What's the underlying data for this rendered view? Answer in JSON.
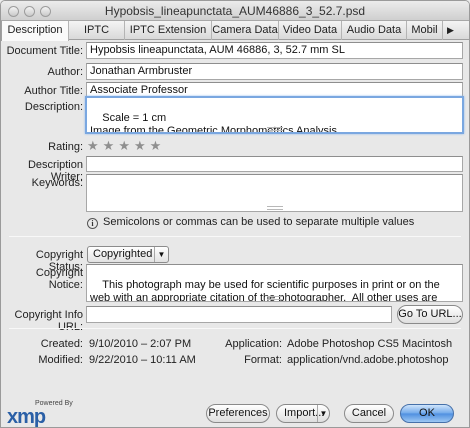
{
  "window": {
    "title": "Hypobsis_lineapunctata_AUM46886_3_52.7.psd"
  },
  "tabs": [
    {
      "label": "Description",
      "active": true
    },
    {
      "label": "IPTC"
    },
    {
      "label": "IPTC Extension"
    },
    {
      "label": "Camera Data"
    },
    {
      "label": "Video Data"
    },
    {
      "label": "Audio Data"
    },
    {
      "label": "Mobil"
    }
  ],
  "tab_scroll_icon": "triangle-right",
  "fields": {
    "document_title": {
      "label": "Document Title:",
      "value": "Hypobsis lineapunctata, AUM 46886, 3, 52.7 mm SL"
    },
    "author": {
      "label": "Author:",
      "value": "Jonathan Armbruster"
    },
    "author_title": {
      "label": "Author Title:",
      "value": "Associate Professor"
    },
    "description": {
      "label": "Description:",
      "value": "Scale = 1 cm\nImage from the Geometric Morphometrics Analysis\nPlease cite J.W. Armbruster as the photographer if you use this image."
    },
    "rating": {
      "label": "Rating:",
      "value": 0,
      "max": 5
    },
    "description_writer": {
      "label": "Description Writer:",
      "value": ""
    },
    "keywords": {
      "label": "Keywords:",
      "value": ""
    },
    "keywords_hint": "Semicolons or commas can be used to separate multiple values",
    "copyright_status": {
      "label": "Copyright Status:",
      "value": "Copyrighted"
    },
    "copyright_notice": {
      "label": "Copyright Notice:",
      "value": "This photograph may be used for scientific purposes in print or on the web with an appropriate citation of the photographer.  All other uses are prohibited without the consent of the author, who can be e-mailed at: armbrjw@auburn.edu."
    },
    "copyright_info_url": {
      "label": "Copyright Info URL:",
      "value": ""
    },
    "go_to_url_label": "Go To URL..."
  },
  "info": {
    "created": {
      "label": "Created:",
      "value": "9/10/2010 – 2:07 PM"
    },
    "modified": {
      "label": "Modified:",
      "value": "9/22/2010 – 10:11 AM"
    },
    "application": {
      "label": "Application:",
      "value": "Adobe Photoshop CS5 Macintosh"
    },
    "format": {
      "label": "Format:",
      "value": "application/vnd.adobe.photoshop"
    }
  },
  "footer": {
    "logo_powered": "Powered By",
    "logo_text": "xmp",
    "preferences": "Preferences",
    "import": "Import...",
    "cancel": "Cancel",
    "ok": "OK"
  },
  "colors": {
    "focus_ring": "#7aa7e0",
    "default_button": "#4e8fe0",
    "logo": "#2a5fa6"
  }
}
